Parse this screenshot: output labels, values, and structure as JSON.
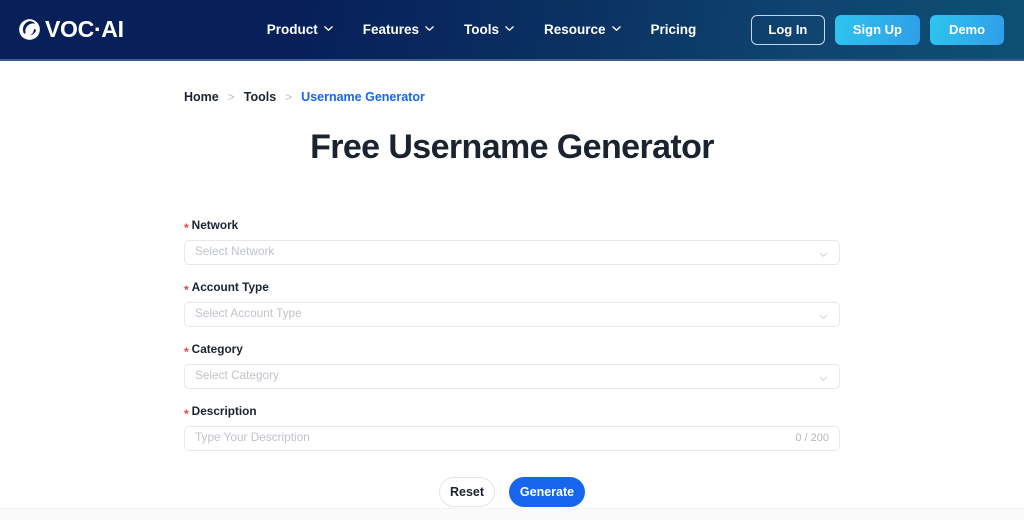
{
  "header": {
    "brand": {
      "icon": "voc-ai-swoosh-logo-icon",
      "text": "VOC·AI"
    },
    "nav": [
      {
        "label": "Product",
        "has_chevron": true,
        "icon": "chevron-down-icon"
      },
      {
        "label": "Features",
        "has_chevron": true,
        "icon": "chevron-down-icon"
      },
      {
        "label": "Tools",
        "has_chevron": true,
        "icon": "chevron-down-icon"
      },
      {
        "label": "Resource",
        "has_chevron": true,
        "icon": "chevron-down-icon"
      },
      {
        "label": "Pricing",
        "has_chevron": false,
        "icon": ""
      }
    ],
    "actions": {
      "login": "Log In",
      "signup": "Sign Up",
      "demo": "Demo"
    },
    "colors": {
      "bg_start": "#07205a",
      "bg_end": "#0d4f74",
      "button_gradient_start": "#2ec5f0",
      "button_gradient_end": "#2f9ee8"
    }
  },
  "breadcrumb": {
    "items": [
      {
        "label": "Home",
        "current": false
      },
      {
        "label": "Tools",
        "current": false
      },
      {
        "label": "Username Generator",
        "current": true
      }
    ],
    "separator": ">",
    "current_color": "#1667ed"
  },
  "main": {
    "title": "Free Username Generator",
    "form": {
      "required_marker": "*",
      "required_marker_color": "#f2403c",
      "fields": [
        {
          "label": "Network",
          "placeholder": "Select Network",
          "value": "",
          "type": "select",
          "icon": "chevron-down-icon"
        },
        {
          "label": "Account Type",
          "placeholder": "Select Account Type",
          "value": "",
          "type": "select",
          "icon": "chevron-down-icon"
        },
        {
          "label": "Category",
          "placeholder": "Select Category",
          "value": "",
          "type": "select",
          "icon": "chevron-down-icon"
        },
        {
          "label": "Description",
          "placeholder": "Type Your Description",
          "value": "",
          "type": "text",
          "counter": "0 / 200"
        }
      ],
      "buttons": {
        "reset": "Reset",
        "generate": "Generate",
        "generate_color": "#1667ed"
      }
    }
  }
}
